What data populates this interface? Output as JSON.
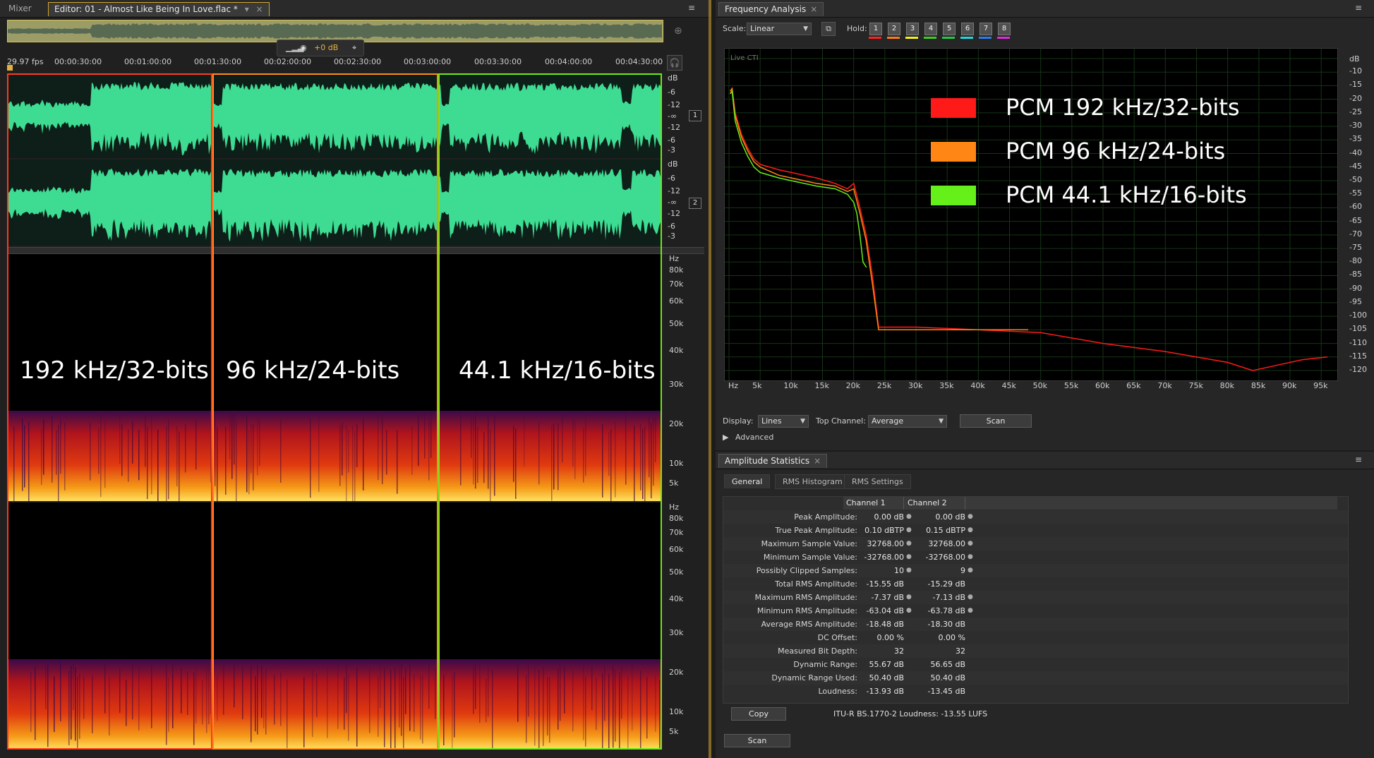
{
  "editor": {
    "tabs": [
      {
        "label": "Mixer"
      },
      {
        "label": "Editor: 01 - Almost Like Being In Love.flac *"
      }
    ],
    "fps": "29.97 fps",
    "hud_gain": "+0 dB",
    "timeline": [
      "00:00:30:00",
      "00:01:00:00",
      "00:01:30:00",
      "00:02:00:00",
      "00:02:30:00",
      "00:03:00:00",
      "00:03:30:00",
      "00:04:00:00",
      "00:04:30:00"
    ],
    "db_scale": [
      "dB",
      "-6",
      "-12",
      "-∞",
      "-12",
      "-6",
      "-3"
    ],
    "channels": [
      "1",
      "2"
    ],
    "hz_scale": [
      "Hz",
      "80k",
      "70k",
      "60k",
      "50k",
      "40k",
      "30k",
      "20k",
      "10k",
      "5k"
    ],
    "section_labels": [
      "192 kHz/32-bits",
      "96 kHz/24-bits",
      "44.1 kHz/16-bits"
    ],
    "section_colors": [
      "#ff3b1f",
      "#ff8c1a",
      "#6fe81a"
    ]
  },
  "frequency": {
    "title": "Frequency Analysis",
    "scale_label": "Scale:",
    "scale_value": "Linear",
    "hold_label": "Hold:",
    "hold_buttons": [
      "1",
      "2",
      "3",
      "4",
      "5",
      "6",
      "7",
      "8"
    ],
    "hold_colors": [
      "#ff2020",
      "#ff7a1a",
      "#f5f020",
      "#3ecb20",
      "#22c84a",
      "#20d6e0",
      "#2a7cf0",
      "#e02ae0"
    ],
    "plot_caption": "Live CTI",
    "display_label": "Display:",
    "display_value": "Lines",
    "top_channel_label": "Top Channel:",
    "top_channel_value": "Average",
    "scan_label": "Scan",
    "advanced_label": "Advanced",
    "chart_data": {
      "type": "line",
      "xlabel": "Hz",
      "ylabel": "dB",
      "xlim": [
        0,
        96000
      ],
      "ylim": [
        -120,
        -5
      ],
      "x_ticks": [
        "Hz",
        "5k",
        "10k",
        "15k",
        "20k",
        "25k",
        "30k",
        "35k",
        "40k",
        "45k",
        "50k",
        "55k",
        "60k",
        "65k",
        "70k",
        "75k",
        "80k",
        "85k",
        "90k",
        "95k"
      ],
      "y_ticks": [
        "dB",
        "-10",
        "-15",
        "-20",
        "-25",
        "-30",
        "-35",
        "-40",
        "-45",
        "-50",
        "-55",
        "-60",
        "-65",
        "-70",
        "-75",
        "-80",
        "-85",
        "-90",
        "-95",
        "-100",
        "-105",
        "-110",
        "-115",
        "-120"
      ],
      "grid": true,
      "legend": [
        {
          "name": "PCM 192 kHz/32-bits",
          "color": "#ff1a1a"
        },
        {
          "name": "PCM 96 kHz/24-bits",
          "color": "#ff8614"
        },
        {
          "name": "PCM 44.1 kHz/16-bits",
          "color": "#66f01a"
        }
      ],
      "series": [
        {
          "name": "PCM 192 kHz/32-bits",
          "color": "#ff1a1a",
          "x": [
            200,
            500,
            1000,
            2000,
            3000,
            4000,
            5000,
            8000,
            10000,
            14000,
            17000,
            19000,
            20000,
            21000,
            22000,
            23000,
            24000,
            25000,
            30000,
            40000,
            50000,
            60000,
            70000,
            80000,
            84000,
            88000,
            92000,
            96000
          ],
          "y": [
            -18,
            -16,
            -25,
            -33,
            -38,
            -42,
            -44,
            -46,
            -47,
            -49,
            -51,
            -53,
            -51,
            -60,
            -70,
            -85,
            -104,
            -104,
            -104,
            -105,
            -106,
            -110,
            -113,
            -117,
            -120,
            -118,
            -116,
            -115
          ]
        },
        {
          "name": "PCM 96 kHz/24-bits",
          "color": "#ff8614",
          "x": [
            200,
            500,
            1000,
            2000,
            3000,
            4000,
            5000,
            8000,
            10000,
            14000,
            17000,
            19000,
            20000,
            21000,
            22000,
            23000,
            24000,
            30000,
            40000,
            48000
          ],
          "y": [
            -17,
            -16,
            -26,
            -34,
            -39,
            -43,
            -45,
            -48,
            -49,
            -51,
            -52,
            -54,
            -53,
            -62,
            -72,
            -88,
            -105,
            -105,
            -105,
            -105
          ]
        },
        {
          "name": "PCM 44.1 kHz/16-bits",
          "color": "#66f01a",
          "x": [
            200,
            500,
            1000,
            2000,
            3000,
            4000,
            5000,
            8000,
            10000,
            14000,
            17000,
            19000,
            20000,
            20500,
            21000,
            21500,
            22050
          ],
          "y": [
            -18,
            -17,
            -28,
            -36,
            -41,
            -45,
            -47,
            -49,
            -50,
            -52,
            -53,
            -55,
            -58,
            -62,
            -70,
            -80,
            -82
          ]
        }
      ]
    }
  },
  "amplitude": {
    "title": "Amplitude Statistics",
    "tabs": [
      "General",
      "RMS Histogram",
      "RMS Settings"
    ],
    "columns": [
      "Channel 1",
      "Channel 2"
    ],
    "rows": [
      {
        "label": "Peak Amplitude:",
        "c1": "0.00 dB",
        "c2": "0.00 dB"
      },
      {
        "label": "True Peak Amplitude:",
        "c1": "0.10 dBTP",
        "c2": "0.15 dBTP"
      },
      {
        "label": "Maximum Sample Value:",
        "c1": "32768.00",
        "c2": "32768.00"
      },
      {
        "label": "Minimum Sample Value:",
        "c1": "-32768.00",
        "c2": "-32768.00"
      },
      {
        "label": "Possibly Clipped Samples:",
        "c1": "10",
        "c2": "9"
      },
      {
        "label": "Total RMS Amplitude:",
        "c1": "-15.55 dB",
        "c2": "-15.29 dB"
      },
      {
        "label": "Maximum RMS Amplitude:",
        "c1": "-7.37 dB",
        "c2": "-7.13 dB"
      },
      {
        "label": "Minimum RMS Amplitude:",
        "c1": "-63.04 dB",
        "c2": "-63.78 dB"
      },
      {
        "label": "Average RMS Amplitude:",
        "c1": "-18.48 dB",
        "c2": "-18.30 dB"
      },
      {
        "label": "DC Offset:",
        "c1": "0.00 %",
        "c2": "0.00 %"
      },
      {
        "label": "Measured Bit Depth:",
        "c1": "32",
        "c2": "32"
      },
      {
        "label": "Dynamic Range:",
        "c1": "55.67 dB",
        "c2": "56.65 dB"
      },
      {
        "label": "Dynamic Range Used:",
        "c1": "50.40 dB",
        "c2": "50.40 dB"
      },
      {
        "label": "Loudness:",
        "c1": "-13.93 dB",
        "c2": "-13.45 dB"
      }
    ],
    "copy_label": "Copy",
    "loudness_note": "ITU-R BS.1770-2 Loudness: -13.55 LUFS",
    "scan_label": "Scan"
  }
}
